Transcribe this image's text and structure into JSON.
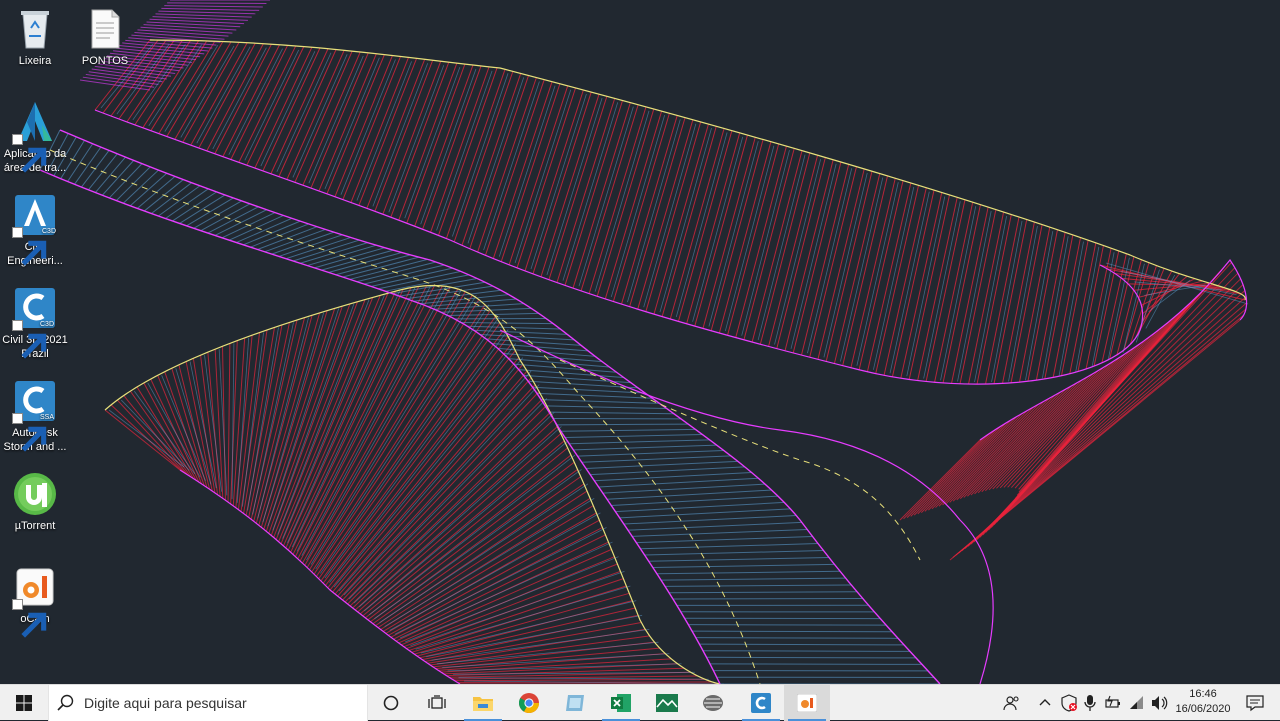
{
  "desktop": {
    "icons": [
      {
        "label": "Lixeira",
        "icon": "recycle-bin-icon"
      },
      {
        "label": "PONTOS",
        "icon": "text-file-icon"
      },
      {
        "label": "Aplicativo da área de tra...",
        "icon": "autodesk-app-icon"
      },
      {
        "label": "Civil Engineeri...",
        "icon": "civil-engineering-icon"
      },
      {
        "label": "Civil 3D 2021 Brazil",
        "icon": "civil3d-icon"
      },
      {
        "label": "Autodesk Storm and ...",
        "icon": "storm-sanitary-icon"
      },
      {
        "label": "µTorrent",
        "icon": "utorrent-icon"
      },
      {
        "label": "oCam",
        "icon": "ocam-icon"
      }
    ],
    "background_color": "#212830"
  },
  "taskbar": {
    "search_placeholder": "Digite aqui para pesquisar",
    "pinned": [
      "start-icon",
      "cortana-icon",
      "task-view-icon",
      "file-explorer-icon",
      "chrome-icon",
      "photos-icon",
      "excel-icon",
      "topograph-icon",
      "network-app-icon",
      "civil3d-taskbar-icon",
      "ocam-taskbar-icon"
    ],
    "tray": [
      "people-icon",
      "show-hidden-icons-icon",
      "defender-icon",
      "microphone-icon",
      "battery-icon",
      "wifi-icon",
      "volume-icon",
      "notification-icon"
    ],
    "clock": {
      "time": "16:46",
      "date": "16/06/2020"
    }
  },
  "colors": {
    "taskbar_bg": "#f0f0f0",
    "line_red": "#e8243c",
    "line_blue": "#5fa3d8",
    "line_magenta": "#e63cff",
    "line_yellow": "#e8e07a"
  }
}
